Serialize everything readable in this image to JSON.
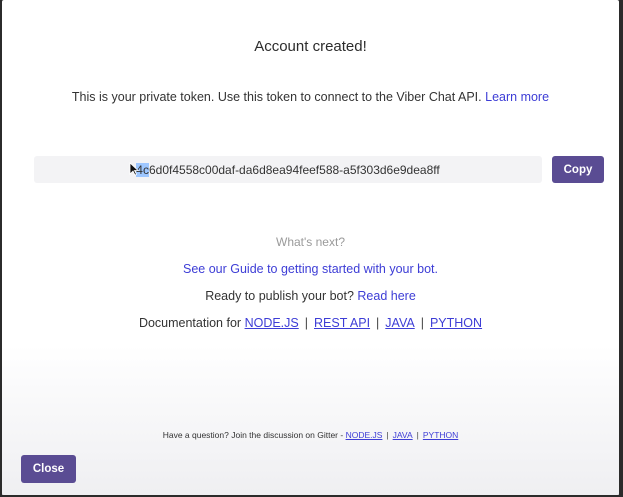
{
  "modal": {
    "title": "Account created!",
    "subtitle": "This is your private token. Use this token to connect to the Viber Chat API.",
    "learn_more": "Learn more"
  },
  "token": {
    "selected_part": "4c",
    "rest": "6d0f4558c00daf-da6d8ea94feef588-a5f303d6e9dea8ff"
  },
  "buttons": {
    "copy": "Copy",
    "close": "Close"
  },
  "next": {
    "heading": "What's next?",
    "guide_link": "See our Guide to getting started with your bot.",
    "publish_text": "Ready to publish your bot?",
    "publish_link": "Read here",
    "docs_text": "Documentation for",
    "docs_links": [
      "NODE.JS",
      "REST API",
      "JAVA",
      "PYTHON"
    ],
    "separator": "|"
  },
  "footer": {
    "question_text": "Have a question? Join the discussion on Gitter -",
    "links": [
      "NODE.JS",
      "JAVA",
      "PYTHON"
    ]
  },
  "icons": {
    "cursor": "text-cursor-icon"
  },
  "colors": {
    "accent": "#5a4c93",
    "link": "#3d3dd6"
  }
}
